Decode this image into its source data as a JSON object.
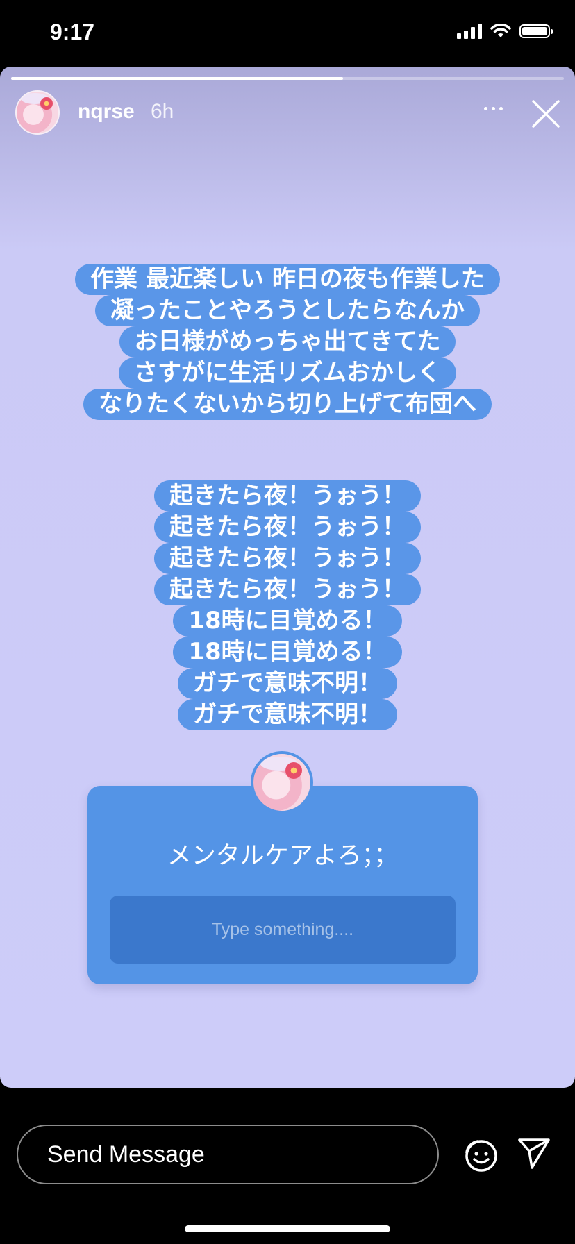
{
  "status_bar": {
    "time": "9:17"
  },
  "story": {
    "progress": 0.6,
    "username": "nqrse",
    "time_ago": "6h",
    "text_block_1": [
      "作業 最近楽しい 昨日の夜も作業した",
      "凝ったことやろうとしたらなんか",
      "お日様がめっちゃ出てきてた",
      "さすがに生活リズムおかしく",
      "なりたくないから切り上げて布団へ"
    ],
    "text_block_2": [
      "起きたら夜！うぉう！",
      "起きたら夜！うぉう！",
      "起きたら夜！うぉう！",
      "起きたら夜！うぉう！",
      "18時に目覚める！",
      "18時に目覚める！",
      "ガチで意味不明！",
      "ガチで意味不明！"
    ],
    "question_sticker": {
      "prompt": "メンタルケアよろ；；",
      "input_placeholder": "Type something...."
    }
  },
  "reply_bar": {
    "send_message_placeholder": "Send Message"
  },
  "colors": {
    "bubble": "#5a96e8",
    "story_bg": "#cdccf9",
    "sticker": "#5494e6"
  }
}
